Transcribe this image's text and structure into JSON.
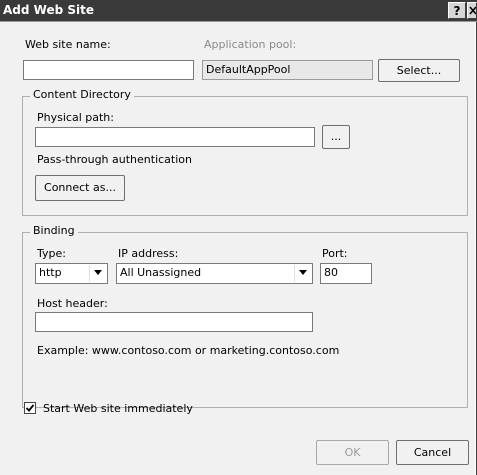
{
  "window": {
    "title": "Add Web Site",
    "help_label": "?",
    "close_label": "X"
  },
  "site": {
    "name_label": "Web site name:",
    "name_value": "",
    "app_pool_label": "Application pool:",
    "app_pool_value": "DefaultAppPool",
    "select_button": "Select..."
  },
  "content_directory": {
    "group_label": "Content Directory",
    "physical_path_label": "Physical path:",
    "physical_path_value": "",
    "browse_button": "...",
    "passthrough_label": "Pass-through authentication",
    "connect_as_button": "Connect as..."
  },
  "binding": {
    "group_label": "Binding",
    "type_label": "Type:",
    "type_value": "http",
    "ip_label": "IP address:",
    "ip_value": "All Unassigned",
    "port_label": "Port:",
    "port_value": "80",
    "host_header_label": "Host header:",
    "host_header_value": "",
    "example_text": "Example: www.contoso.com or marketing.contoso.com"
  },
  "start_immediately": {
    "label": "Start Web site immediately",
    "checked": true
  },
  "footer": {
    "ok_button": "OK",
    "cancel_button": "Cancel"
  }
}
